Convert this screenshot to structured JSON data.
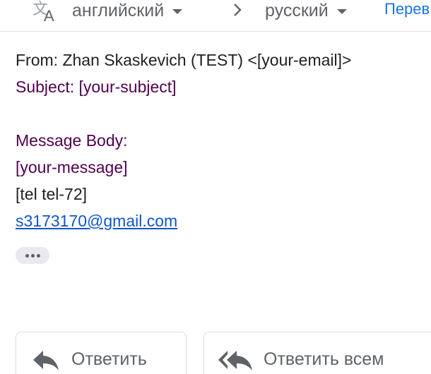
{
  "translate_bar": {
    "source_language": "английский",
    "target_language": "русский",
    "translate_link": "Перев"
  },
  "message": {
    "from_line": "From: Zhan Skaskevich (TEST) <[your-email]>",
    "subject_line": "Subject: [your-subject]",
    "body_heading": "Message Body:",
    "body_placeholder": "[your-message]",
    "tel_placeholder": "[tel tel-72]",
    "email_link": "s3173170@gmail.com"
  },
  "actions": {
    "reply_label": "Ответить",
    "reply_all_label": "Ответить всем"
  },
  "colors": {
    "purple_text": "#500050",
    "link_blue": "#1155cc",
    "accent_blue": "#1a73e8",
    "icon_gray": "#5f6368"
  }
}
